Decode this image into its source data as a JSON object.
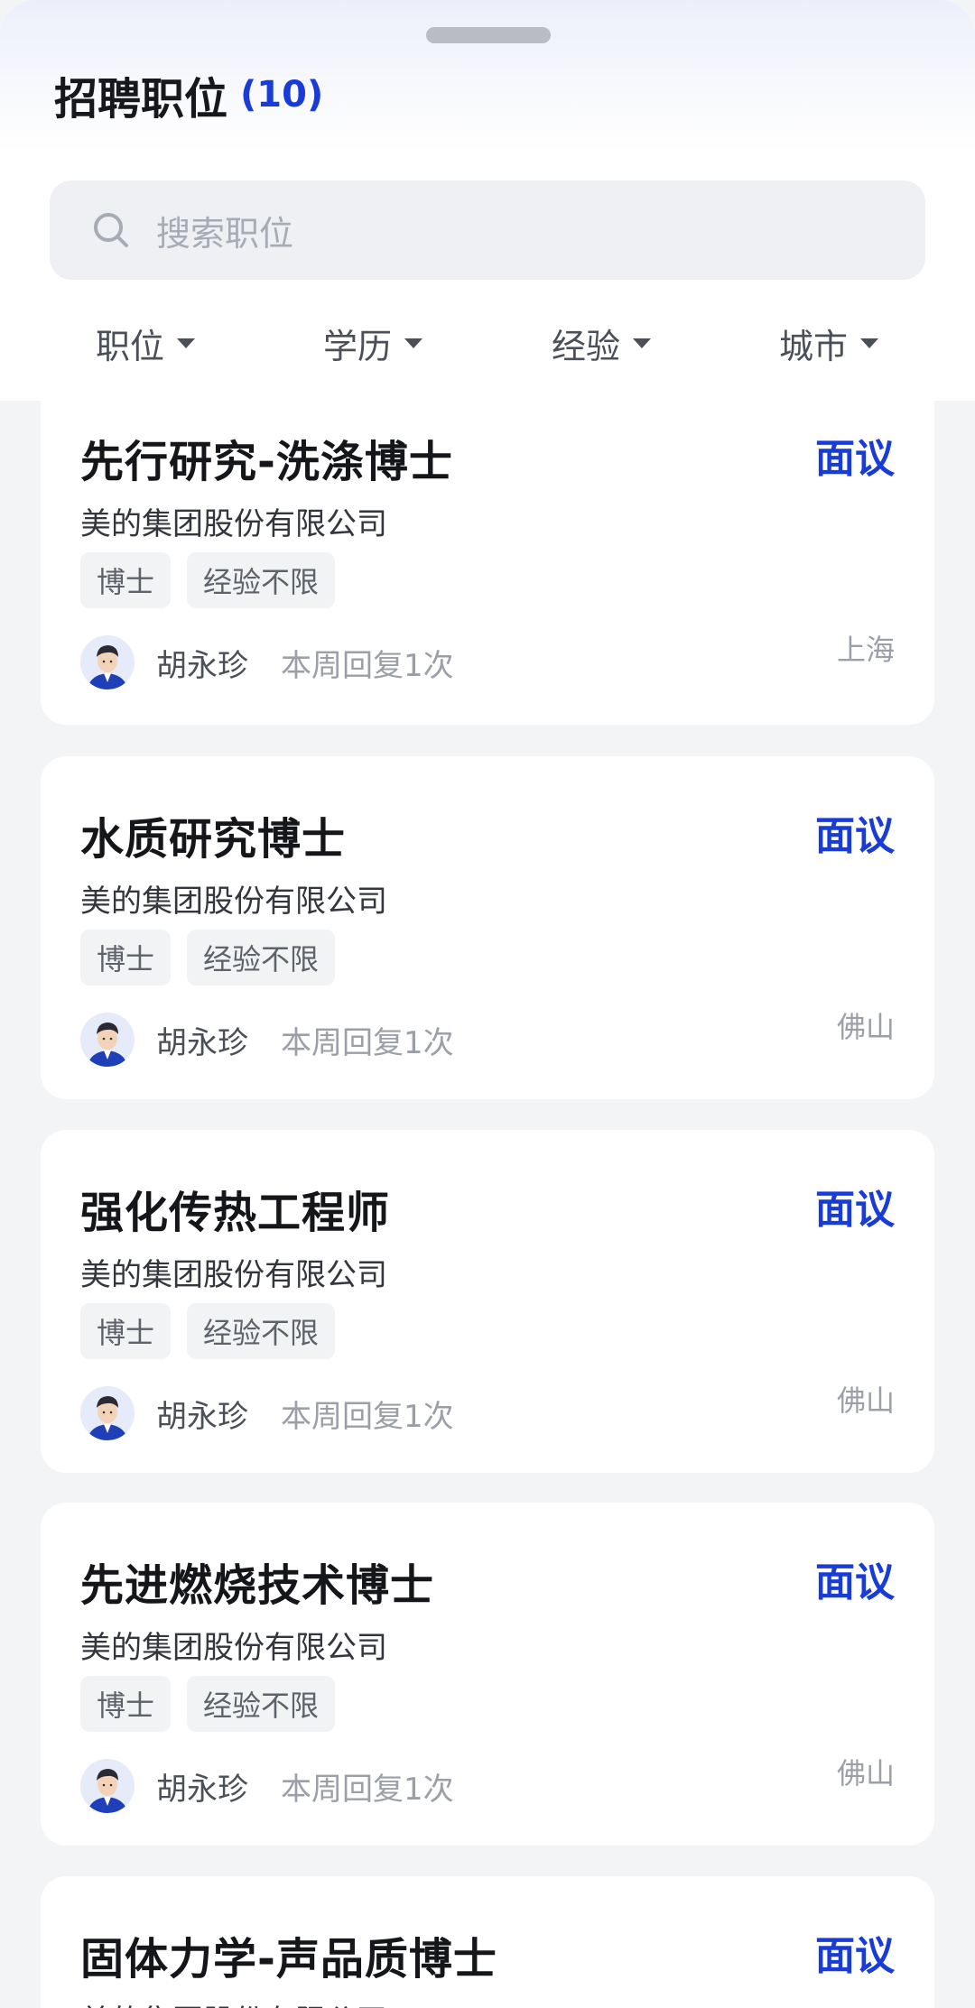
{
  "header": {
    "title": "招聘职位",
    "count": "(10)",
    "search_placeholder": "搜索职位",
    "filters": [
      "职位",
      "学历",
      "经验",
      "城市"
    ]
  },
  "jobs": [
    {
      "title": "先行研究-洗涤博士",
      "salary": "面议",
      "company": "美的集团股份有限公司",
      "tags": [
        "博士",
        "经验不限"
      ],
      "recruiter": "胡永珍",
      "activity": "本周回复1次",
      "city": "上海"
    },
    {
      "title": "水质研究博士",
      "salary": "面议",
      "company": "美的集团股份有限公司",
      "tags": [
        "博士",
        "经验不限"
      ],
      "recruiter": "胡永珍",
      "activity": "本周回复1次",
      "city": "佛山"
    },
    {
      "title": "强化传热工程师",
      "salary": "面议",
      "company": "美的集团股份有限公司",
      "tags": [
        "博士",
        "经验不限"
      ],
      "recruiter": "胡永珍",
      "activity": "本周回复1次",
      "city": "佛山"
    },
    {
      "title": "先进燃烧技术博士",
      "salary": "面议",
      "company": "美的集团股份有限公司",
      "tags": [
        "博士",
        "经验不限"
      ],
      "recruiter": "胡永珍",
      "activity": "本周回复1次",
      "city": "佛山"
    },
    {
      "title": "固体力学-声品质博士",
      "salary": "面议",
      "company": "美的集团股份有限公司",
      "tags": [],
      "recruiter": "",
      "activity": "",
      "city": ""
    }
  ],
  "colors": {
    "accent": "#1a3cd6",
    "background": "#f3f4f6"
  },
  "icons": {
    "search": "search-icon",
    "caret": "caret-down-icon",
    "avatar": "recruiter-avatar"
  }
}
